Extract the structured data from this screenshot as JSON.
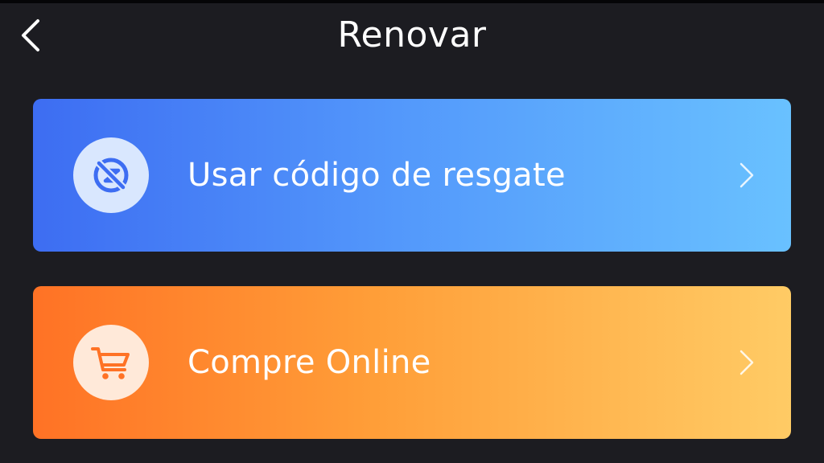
{
  "header": {
    "title": "Renovar",
    "back_icon": "chevron-left-icon"
  },
  "options": [
    {
      "label": "Usar código de resgate",
      "icon": "redeem-code-icon",
      "gradient": [
        "#3d6df2",
        "#69c1ff"
      ],
      "icon_color": "#3d6df2"
    },
    {
      "label": "Compre Online",
      "icon": "shopping-cart-icon",
      "gradient": [
        "#ff7225",
        "#ffcb65"
      ],
      "icon_color": "#ff7225"
    }
  ],
  "colors": {
    "background": "#1c1c21",
    "text": "#ffffff"
  }
}
